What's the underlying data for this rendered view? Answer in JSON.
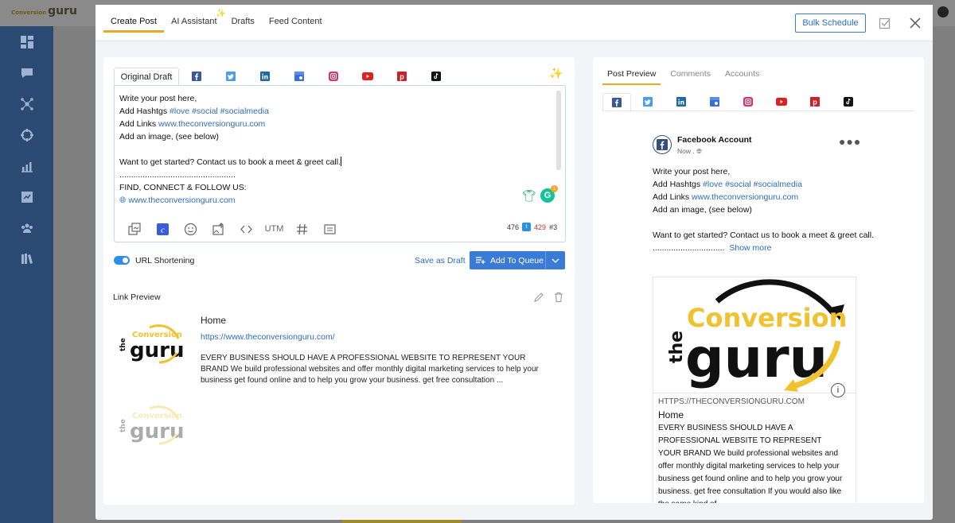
{
  "app": {
    "logo_small": "Conversion",
    "logo_main": "guru"
  },
  "modal": {
    "tabs": [
      {
        "label": "Create Post",
        "active": true
      },
      {
        "label": "AI Assistant",
        "active": false
      },
      {
        "label": "Drafts",
        "active": false
      },
      {
        "label": "Feed Content",
        "active": false
      }
    ],
    "bulk_schedule_label": "Bulk Schedule"
  },
  "editor": {
    "active_tab": "Original Draft",
    "network_tabs": [
      "facebook-icon",
      "twitter-icon",
      "linkedin-icon",
      "google-business-icon",
      "instagram-icon",
      "youtube-icon",
      "pinterest-icon",
      "tiktok-icon"
    ],
    "lines": {
      "l1": "Write your post here,",
      "l2_pre": "Add Hashtgs ",
      "l2_tags": "#love #social #socialmedia",
      "l3_pre": "Add Links ",
      "l3_link": "www.theconversionguru.com",
      "l4": "Add an image, (see below)",
      "l6": "Want to get started?  Contact us to book a meet & greet call.",
      "l7": "..................................................",
      "l8": "FIND, CONNECT & FOLLOW US:",
      "l9_link": "www.theconversionguru.com"
    },
    "grammarly_badge": "1",
    "utm_label": "UTM",
    "counts": {
      "facebook": "476",
      "twitter": "429",
      "hashtags": "3"
    }
  },
  "actions": {
    "url_shortening_label": "URL Shortening",
    "url_shortening_on": true,
    "save_draft_label": "Save as Draft",
    "add_to_queue_label": "Add To Queue"
  },
  "link_preview": {
    "section_title": "Link Preview",
    "title": "Home",
    "url": "https://www.theconversionguru.com/",
    "description": "EVERY BUSINESS SHOULD HAVE A PROFESSIONAL WEBSITE TO REPRESENT YOUR BRAND We build professional websites and offer monthly digital marketing services to help your business get found online and to help you grow your business. get free consultation ..."
  },
  "preview": {
    "tabs": [
      {
        "label": "Post Preview",
        "active": true
      },
      {
        "label": "Comments",
        "active": false
      },
      {
        "label": "Accounts",
        "active": false
      }
    ],
    "account_name": "Facebook Account",
    "time": "Now .",
    "post_lines": {
      "l1": "Write your post here,",
      "l2_pre": "Add Hashtgs ",
      "l2_tags": "#love #social #socialmedia",
      "l3_pre": "Add Links ",
      "l3_link": "www.theconversionguru.com",
      "l4": "Add an image, (see below)",
      "l6": "Want to get started? Contact us to book a meet & greet call.",
      "l7": "...............................",
      "show_more": "Show more"
    },
    "card": {
      "domain": "HTTPS://THECONVERSIONGURU.COM",
      "title": "Home",
      "description": "EVERY BUSINESS SHOULD HAVE A PROFESSIONAL WEBSITE TO REPRESENT YOUR BRAND We build professional websites and offer monthly digital marketing services to help your business get found online and to help you grow your business. get free consultation If you would also like the same kind of"
    }
  },
  "logo_art": {
    "top": "the",
    "middle": "Conversion",
    "bottom": "guru"
  },
  "colors": {
    "accent": "#e8a92a",
    "primary": "#3a7bd5",
    "link": "#2d6cc4",
    "nav": "#2a4a74",
    "logo_yellow": "#f2c12e"
  }
}
